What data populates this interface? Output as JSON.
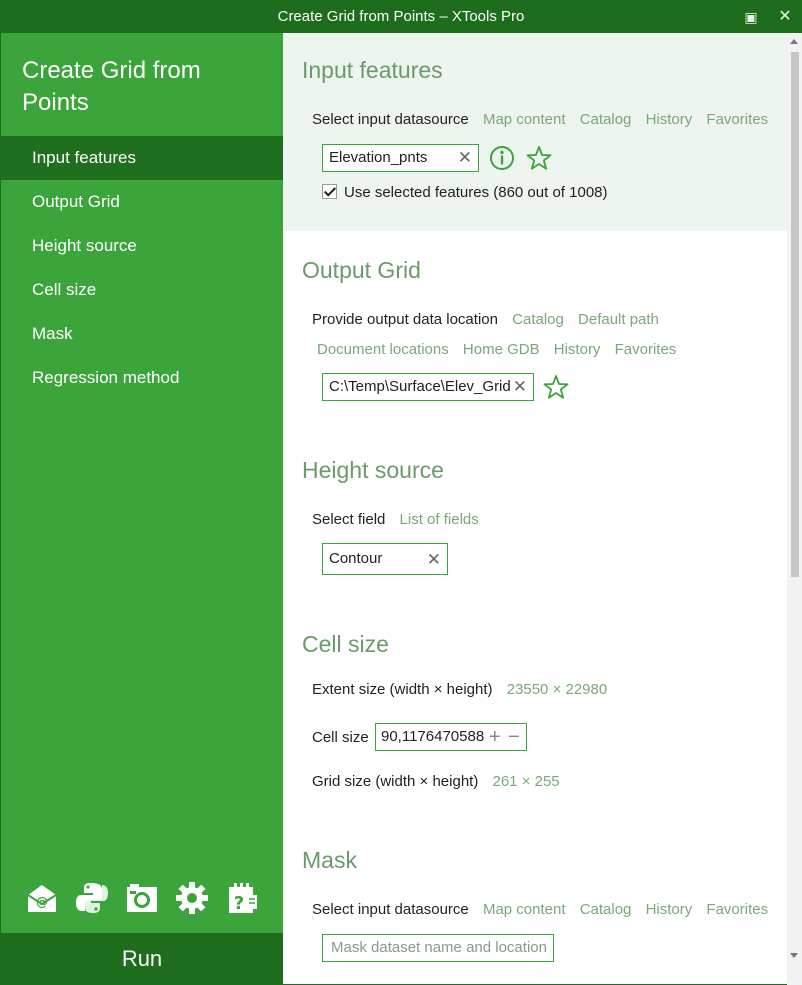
{
  "window": {
    "title": "Create Grid from Points – XTools Pro",
    "maximize_glyph": "▣",
    "close_glyph": "✕"
  },
  "sidebar": {
    "title": "Create Grid from Points",
    "items": [
      {
        "label": "Input features",
        "active": true
      },
      {
        "label": "Output Grid"
      },
      {
        "label": "Height source"
      },
      {
        "label": "Cell size"
      },
      {
        "label": "Mask"
      },
      {
        "label": "Regression method"
      }
    ],
    "icons": [
      "email-icon",
      "python-icon",
      "camera-icon",
      "gear-icon",
      "help-icon"
    ],
    "run_label": "Run"
  },
  "input_features": {
    "title": "Input features",
    "select_label": "Select input datasource",
    "links": [
      "Map content",
      "Catalog",
      "History",
      "Favorites"
    ],
    "value": "Elevation_pnts",
    "use_selected_label": "Use selected features (860 out of 1008)",
    "use_selected_checked": true
  },
  "output_grid": {
    "title": "Output Grid",
    "provide_label": "Provide output data location",
    "links_row1": [
      "Catalog",
      "Default path"
    ],
    "links_row2": [
      "Document locations",
      "Home GDB",
      "History",
      "Favorites"
    ],
    "value": "C:\\Temp\\Surface\\Elev_Grid"
  },
  "height_source": {
    "title": "Height source",
    "select_label": "Select field",
    "link": "List of fields",
    "value": "Contour"
  },
  "cell_size": {
    "title": "Cell size",
    "extent_label": "Extent size (width × height)",
    "extent_value": "23550 × 22980",
    "cell_label": "Cell size",
    "cell_value": "90,1176470588",
    "grid_label": "Grid size (width × height)",
    "grid_value": "261 × 255"
  },
  "mask": {
    "title": "Mask",
    "select_label": "Select input datasource",
    "links": [
      "Map content",
      "Catalog",
      "History",
      "Favorites"
    ],
    "placeholder": "Mask dataset name and location"
  },
  "colors": {
    "sidebar": "#3ba43b",
    "dark_green": "#1d6d1d",
    "link_green": "#7aa87a",
    "title_green": "#6b9a6b",
    "tint": "#eef5ee"
  }
}
